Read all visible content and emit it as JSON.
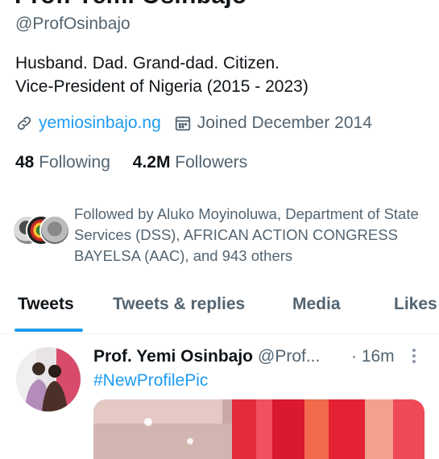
{
  "profile": {
    "name": "Prof. Yemi Osinbajo",
    "handle": "@ProfOsinbajo",
    "bio_line1": "Husband. Dad. Grand-dad. Citizen.",
    "bio_line2": "Vice-President of Nigeria (2015 - 2023)",
    "website": "yemiosinbajo.ng",
    "joined": "Joined December 2014",
    "following_count": "48",
    "following_label": "Following",
    "followers_count": "4.2M",
    "followers_label": "Followers"
  },
  "followed_by": {
    "text": "Followed by Aluko Moyinoluwa, Department of State Services (DSS), AFRICAN ACTION CONGRESS BAYELSA (AAC), and 943 others"
  },
  "tabs": [
    {
      "label": "Tweets",
      "active": true
    },
    {
      "label": "Tweets & replies",
      "active": false
    },
    {
      "label": "Media",
      "active": false
    },
    {
      "label": "Likes",
      "active": false
    }
  ],
  "tweet": {
    "author_name": "Prof. Yemi Osinbajo",
    "author_handle": "@Prof...",
    "time": "· 16m",
    "text": "#NewProfilePic"
  },
  "colors": {
    "accent": "#1d9bf0",
    "text_primary": "#0f1419",
    "text_secondary": "#536471"
  },
  "icons": {
    "link": "link-icon",
    "calendar": "calendar-icon",
    "more": "more-dots-icon"
  }
}
